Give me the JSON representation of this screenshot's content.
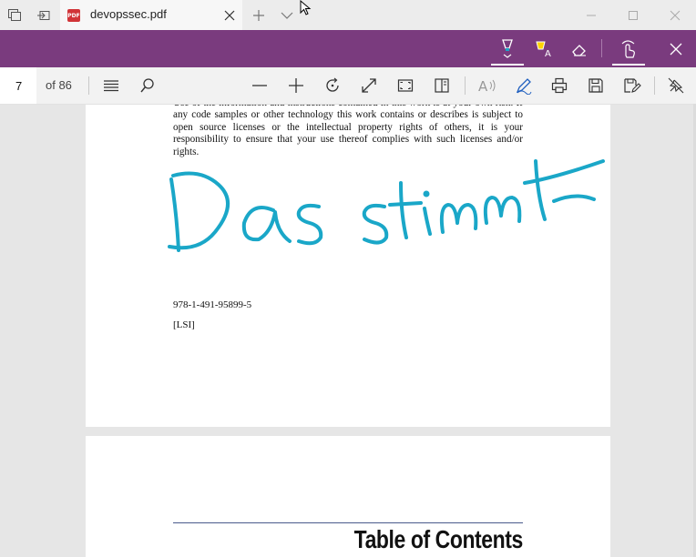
{
  "titlebar": {
    "tab_title": "devopssec.pdf",
    "tab_icon_label": "PDF"
  },
  "inkbar": {
    "active_color": "#1aa7c8",
    "accent": "#7a3b7e"
  },
  "toolbar": {
    "page_number": "7",
    "page_total": "of 86"
  },
  "document": {
    "page1": {
      "legal_text": "Use of the information and instructions contained in this work is at your own risk. If any code samples or other technology this work contains or describes is subject to open source licenses or the intellectual property rights of others, it is your responsibility to ensure that your use thereof complies with such licenses and/or rights.",
      "isbn": "978-1-491-95899-5",
      "lsi": "[LSI]"
    },
    "page2": {
      "heading": "Table of Contents"
    },
    "handwriting": "Das stimmt"
  }
}
